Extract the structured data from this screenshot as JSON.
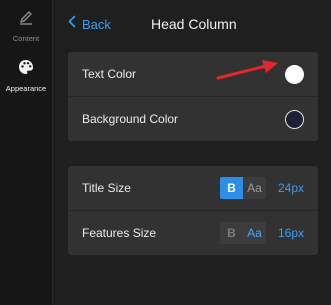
{
  "sidebar": {
    "items": [
      {
        "label": "Content",
        "icon": "pen-icon",
        "active": false
      },
      {
        "label": "Appearance",
        "icon": "palette-icon",
        "active": true
      }
    ]
  },
  "header": {
    "back_label": "Back",
    "title": "Head Column"
  },
  "colors_panel": {
    "rows": [
      {
        "label": "Text Color",
        "swatch_color": "#ffffff"
      },
      {
        "label": "Background Color",
        "swatch_color": "#1a2233"
      }
    ]
  },
  "size_panel": {
    "rows": [
      {
        "label": "Title Size",
        "bold_glyph": "B",
        "aa_glyph": "Aa",
        "bold_active": true,
        "value": "24px"
      },
      {
        "label": "Features Size",
        "bold_glyph": "B",
        "aa_glyph": "Aa",
        "bold_active": false,
        "value": "16px"
      }
    ]
  },
  "annotation": {
    "color": "#e0282e",
    "icon": "red-arrow-icon"
  },
  "theme": {
    "accent": "#3d9cf5"
  }
}
